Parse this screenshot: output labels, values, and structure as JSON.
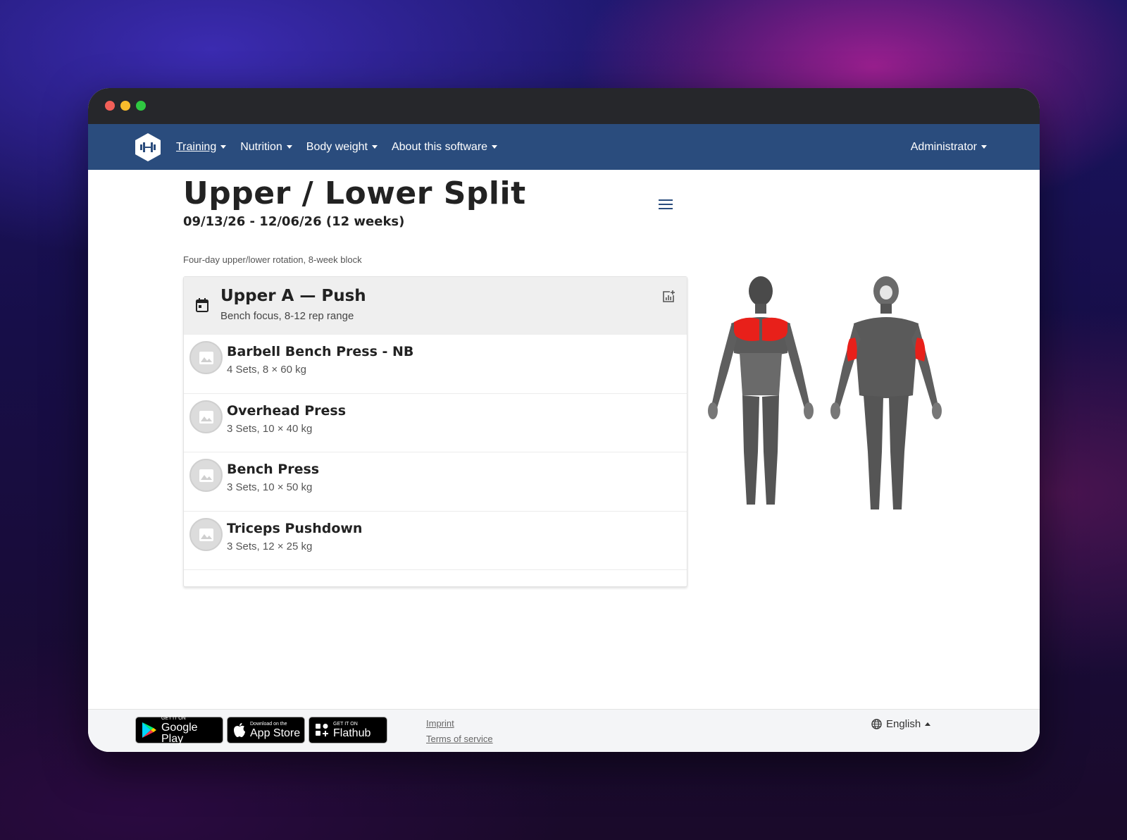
{
  "nav": {
    "items": [
      {
        "label": "Training"
      },
      {
        "label": "Nutrition"
      },
      {
        "label": "Body weight"
      },
      {
        "label": "About this software"
      }
    ],
    "user": "Administrator"
  },
  "routine": {
    "title": "Upper / Lower Split",
    "dates": "09/13/26 - 12/06/26 (12 weeks)",
    "description": "Four-day upper/lower rotation, 8-week block"
  },
  "day": {
    "title": "Upper A — Push",
    "subtitle": "Bench focus, 8-12 rep range"
  },
  "exercises": [
    {
      "name": "Barbell Bench Press - NB",
      "sets": "4 Sets, 8 × 60 kg"
    },
    {
      "name": "Overhead Press",
      "sets": "3 Sets, 10 × 40 kg"
    },
    {
      "name": "Bench Press",
      "sets": "3 Sets, 10 × 50 kg"
    },
    {
      "name": "Triceps Pushdown",
      "sets": "3 Sets, 12 × 25 kg"
    }
  ],
  "footer": {
    "google": {
      "small": "GET IT ON",
      "big": "Google Play"
    },
    "apple": {
      "small": "Download on the",
      "big": "App Store"
    },
    "flathub": {
      "small": "GET IT ON",
      "big": "Flathub"
    },
    "imprint": "Imprint",
    "terms": "Terms of service",
    "language": "English"
  },
  "colors": {
    "navbar": "#2a4c7d",
    "highlight_muscle": "#e8201a"
  }
}
